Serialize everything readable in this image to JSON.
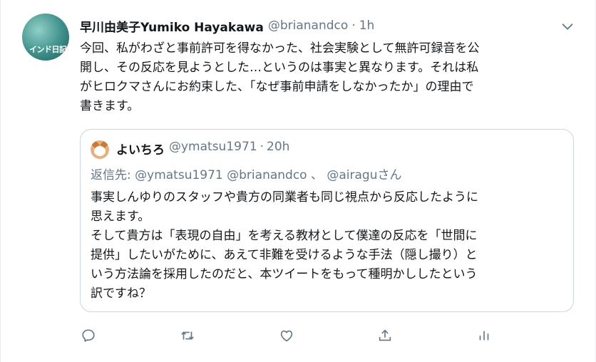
{
  "tweet": {
    "author_name": "早川由美子Yumiko Hayakawa",
    "author_handle": "@brianandco",
    "separator": "·",
    "time": "1h",
    "avatar_text": "インド日記",
    "text": "今回、私がわざと事前許可を得なかった、社会実験として無許可録音を公\n開し、その反応を見ようとした…というのは事実と異なります。それは私\nがヒロクマさんにお約束した、「なぜ事前申請をしなかったか」の理由で\n書きます。"
  },
  "quoted": {
    "author_name": "よいちろ",
    "author_handle": "@ymatsu1971",
    "separator": "·",
    "time": "20h",
    "replying_prefix": "返信先: ",
    "replying_handles": "@ymatsu1971 @brianandco 、 @airagu",
    "replying_suffix": "さん",
    "text": "事実しんゆりのスタッフや貴方の同業者も同じ視点から反応したように\n思えます。\nそして貴方は「表現の自由」を考える教材として僕達の反応を「世間に\n提供」したいがために、あえて非難を受けるような手法（隠し撮り）と\nいう方法論を採用したのだと、本ツイートをもって種明かししたという\n訳ですね？"
  },
  "actions": {
    "icons": [
      "reply-icon",
      "retweet-icon",
      "like-icon",
      "share-icon",
      "analytics-icon"
    ]
  },
  "colors": {
    "text": "#14171a",
    "secondary": "#657786",
    "border": "#ccd6dd"
  }
}
